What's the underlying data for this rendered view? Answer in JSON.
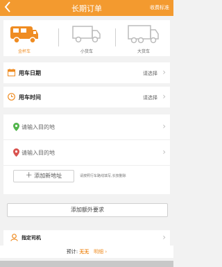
{
  "header": {
    "back_icon": "chevron-left-icon",
    "title": "长期订单",
    "rate_label": "收费标准",
    "background": "#f39a2f"
  },
  "vehicles": [
    {
      "label": "金杯车",
      "active": true,
      "icon": "van-icon"
    },
    {
      "label": "小货车",
      "active": false,
      "icon": "small-truck-icon"
    },
    {
      "label": "大货车",
      "active": false,
      "icon": "large-truck-icon"
    }
  ],
  "date_row": {
    "label": "用车日期",
    "value": "请选择"
  },
  "time_row": {
    "label": "用车时间",
    "value": "请选择"
  },
  "addresses": [
    {
      "placeholder": "请输入目的地",
      "pin_color": "#53b54d"
    },
    {
      "placeholder": "请输入目的地",
      "pin_color": "#d9534f"
    }
  ],
  "add_address": {
    "icon": "plus-icon",
    "label": "添加新地址",
    "hint": "请按照行车路线填写,长按删除"
  },
  "extra_button": {
    "label": "添加额外要求"
  },
  "driver_row": {
    "label": "指定司机"
  },
  "price": {
    "label": "预计:",
    "value": "无无",
    "detail": "明细"
  },
  "accent": "#ef8c22"
}
